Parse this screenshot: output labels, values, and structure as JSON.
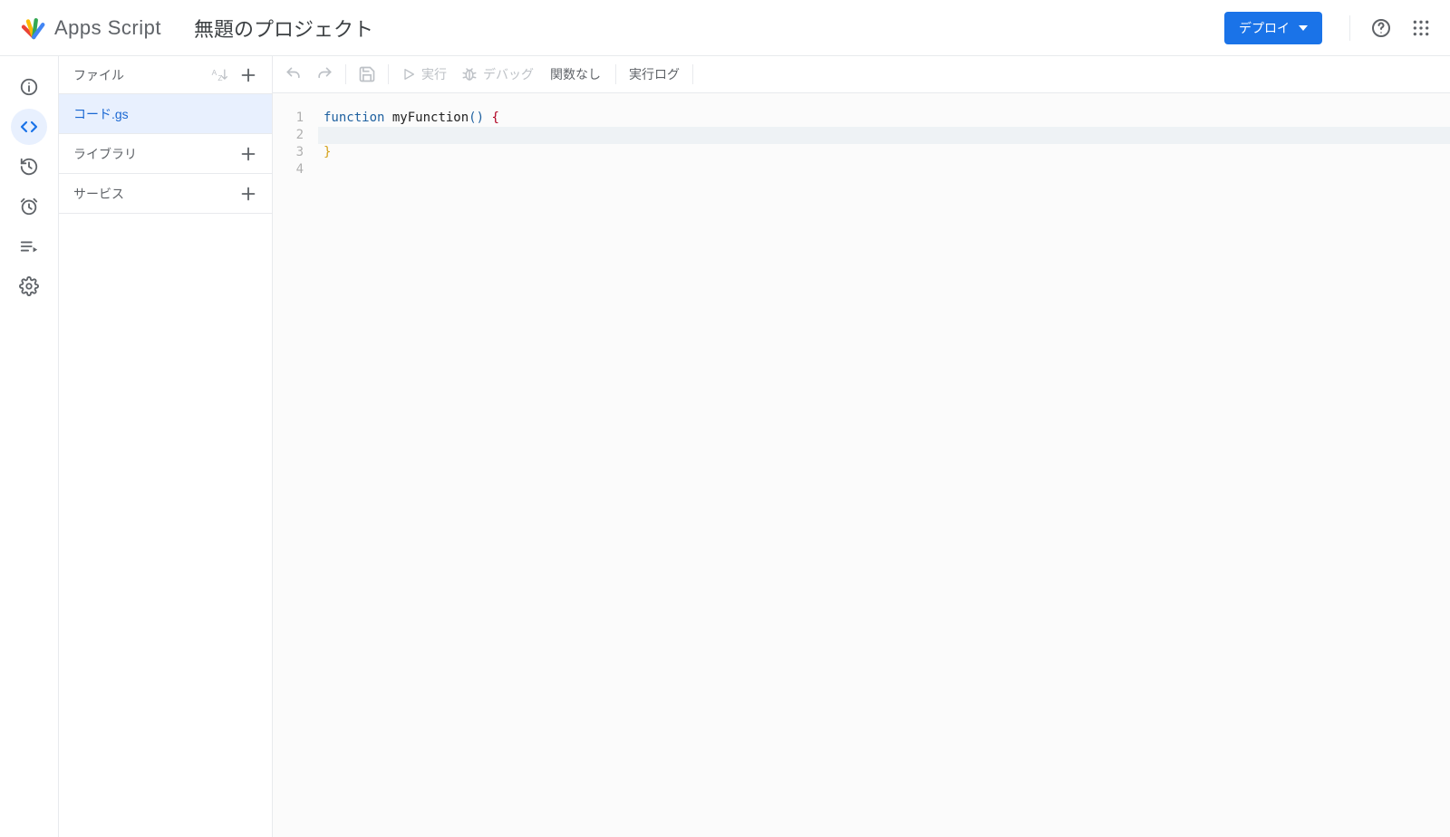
{
  "header": {
    "app_name": "Apps Script",
    "project_title": "無題のプロジェクト",
    "deploy_label": "デプロイ"
  },
  "nav_rail": {
    "items": [
      {
        "name": "overview",
        "icon": "info"
      },
      {
        "name": "editor",
        "icon": "code",
        "active": true
      },
      {
        "name": "history",
        "icon": "history"
      },
      {
        "name": "triggers",
        "icon": "clock"
      },
      {
        "name": "executions",
        "icon": "playlist"
      },
      {
        "name": "settings",
        "icon": "gear"
      }
    ]
  },
  "files_panel": {
    "files_header": "ファイル",
    "file_name": "コード.gs",
    "libraries_label": "ライブラリ",
    "services_label": "サービス"
  },
  "toolbar": {
    "run_label": "実行",
    "debug_label": "デバッグ",
    "function_select": "関数なし",
    "execution_log_label": "実行ログ"
  },
  "editor": {
    "lines": [
      {
        "n": 1,
        "tokens": [
          {
            "t": "function",
            "c": "kw"
          },
          {
            "t": " ",
            "c": ""
          },
          {
            "t": "myFunction",
            "c": "fn"
          },
          {
            "t": "()",
            "c": "paren"
          },
          {
            "t": " ",
            "c": ""
          },
          {
            "t": "{",
            "c": "brace"
          }
        ]
      },
      {
        "n": 2,
        "tokens": [
          {
            "t": "  ",
            "c": ""
          }
        ],
        "current": true
      },
      {
        "n": 3,
        "tokens": [
          {
            "t": "}",
            "c": "yellow"
          }
        ]
      },
      {
        "n": 4,
        "tokens": [
          {
            "t": "",
            "c": ""
          }
        ]
      }
    ]
  }
}
